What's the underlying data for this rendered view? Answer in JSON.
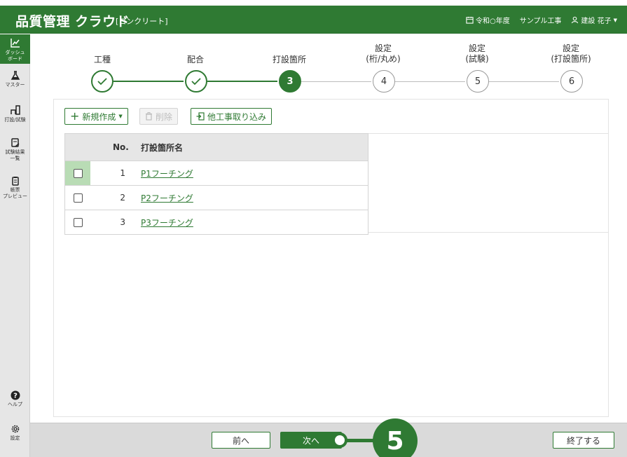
{
  "header": {
    "title": "品質管理 クラウド",
    "subtitle": "[コンクリート]",
    "fiscal_year": "令和○年度",
    "project": "サンプル工事",
    "user": "建設 花子"
  },
  "sidebar": {
    "items": [
      {
        "label1": "ダッシュ",
        "label2": "ボード",
        "icon": "chart-icon",
        "active": true
      },
      {
        "label1": "マスター",
        "label2": "",
        "icon": "flask-icon"
      },
      {
        "label1": "打設/試験",
        "label2": "",
        "icon": "pour-icon"
      },
      {
        "label1": "試験結果",
        "label2": "一覧",
        "icon": "result-icon"
      },
      {
        "label1": "帳票",
        "label2": "プレビュー",
        "icon": "report-icon"
      }
    ],
    "help": "ヘルプ",
    "settings": "設定"
  },
  "stepper": {
    "steps": [
      {
        "label1": "工種",
        "label2": "",
        "number": "",
        "status": "done"
      },
      {
        "label1": "配合",
        "label2": "",
        "number": "",
        "status": "done"
      },
      {
        "label1": "打設箇所",
        "label2": "",
        "number": "3",
        "status": "current"
      },
      {
        "label1": "設定",
        "label2": "(桁/丸め)",
        "number": "4",
        "status": "todo"
      },
      {
        "label1": "設定",
        "label2": "(試験)",
        "number": "5",
        "status": "todo"
      },
      {
        "label1": "設定",
        "label2": "(打設箇所)",
        "number": "6",
        "status": "todo"
      }
    ]
  },
  "toolbar": {
    "new_label": "新規作成",
    "delete_label": "削除",
    "import_label": "他工事取り込み"
  },
  "table": {
    "col_no": "No.",
    "col_name": "打設箇所名",
    "rows": [
      {
        "no": "1",
        "name": "P1フーチング"
      },
      {
        "no": "2",
        "name": "P2フーチング"
      },
      {
        "no": "3",
        "name": "P3フーチング"
      }
    ]
  },
  "footer": {
    "prev_label": "前へ",
    "next_label": "次へ",
    "finish_label": "終了する"
  },
  "callout": {
    "number": "5"
  },
  "colors": {
    "brand": "#2f7a33",
    "row_highlight": "#b9dcb5"
  }
}
